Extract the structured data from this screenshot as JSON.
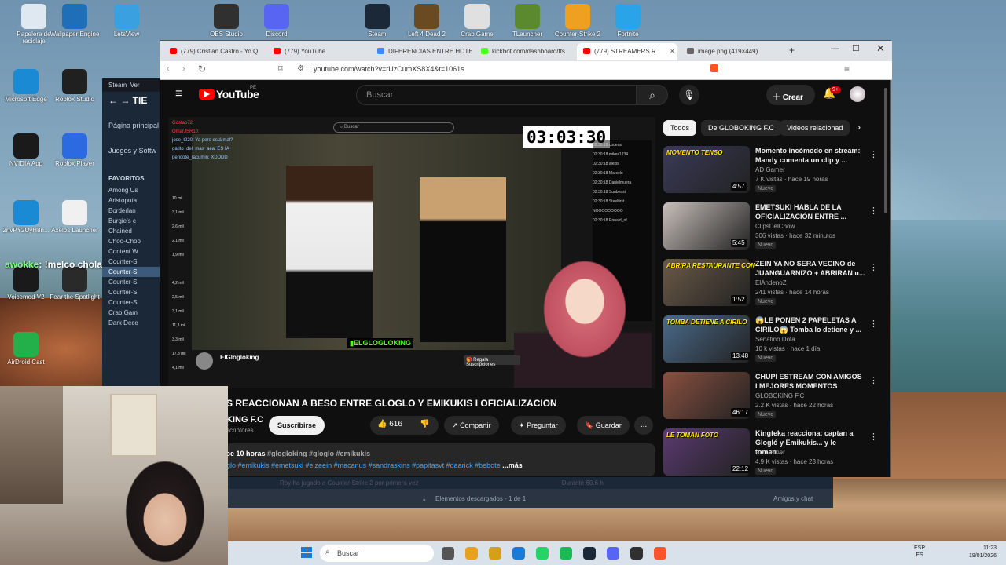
{
  "desktop_icons": [
    {
      "label": "Papelera de reciclaje",
      "icon": "recycle-bin-icon",
      "color": "#dfe8f0"
    },
    {
      "label": "Wallpaper Engine",
      "icon": "wallpaper-engine-icon",
      "color": "#1f6fb8"
    },
    {
      "label": "LetsView",
      "icon": "letsview-icon",
      "color": "#3aa0e0"
    },
    {
      "label": "OBS Studio",
      "icon": "obs-icon",
      "color": "#303030"
    },
    {
      "label": "Discord",
      "icon": "discord-icon",
      "color": "#5865f2"
    },
    {
      "label": "Steam",
      "icon": "steam-icon",
      "color": "#1b2838"
    },
    {
      "label": "Left 4 Dead 2",
      "icon": "l4d2-icon",
      "color": "#6a4a20"
    },
    {
      "label": "Crab Game",
      "icon": "crab-game-icon",
      "color": "#e0e0e0"
    },
    {
      "label": "TLauncher",
      "icon": "tlauncher-icon",
      "color": "#5b8a2e"
    },
    {
      "label": "Counter-Strike 2",
      "icon": "cs2-icon",
      "color": "#f0a020"
    },
    {
      "label": "Fortnite",
      "icon": "fortnite-icon",
      "color": "#2aa4e8"
    },
    {
      "label": "Microsoft Edge",
      "icon": "edge-icon",
      "color": "#1a8ad4"
    },
    {
      "label": "Roblox Studio",
      "icon": "roblox-studio-icon",
      "color": "#202020"
    },
    {
      "label": "NVIDIA App",
      "icon": "nvidia-icon",
      "color": "#1a1a1a"
    },
    {
      "label": "Roblox Player",
      "icon": "roblox-player-icon",
      "color": "#2b6ae0"
    },
    {
      "label": "2nvPY2UyH8n...",
      "icon": "edge-beta-icon",
      "color": "#1a8ad4"
    },
    {
      "label": "Axelos Launcher",
      "icon": "file-icon",
      "color": "#f0f0f0"
    },
    {
      "label": "Voicemod V2",
      "icon": "voicemod-icon",
      "color": "#1a1a1a"
    },
    {
      "label": "Fear the Spotlight",
      "icon": "fear-spotlight-icon",
      "color": "#2a2a2a"
    },
    {
      "label": "AirDroid Cast",
      "icon": "airdroid-icon",
      "color": "#23b04a"
    }
  ],
  "overlay_chat": {
    "user": "awokke",
    "message": ": !melco chola dime si le aguantarías un round a seb"
  },
  "steam": {
    "title": "Steam",
    "menu": "Ver",
    "heading": "TIE",
    "page": "Página principal",
    "games": "Juegos y Softw",
    "favorites": "FAVORITOS",
    "items": [
      "Among Us",
      "Aristoputa",
      "Borderlan",
      "Burgie's c",
      "Chained",
      "Choo-Choo",
      "Content W",
      "Counter-S",
      "Counter-S",
      "Counter-S",
      "Counter-S",
      "Counter-S",
      "Crab Gam",
      "Dark Dece"
    ],
    "footer": "Roy ha jugado a Counter-Strike 2 por primera vez"
  },
  "browser": {
    "tabs": [
      {
        "label": "(779) Cristian Castro - Yo Q",
        "color": "#ff0000"
      },
      {
        "label": "(779) YouTube",
        "color": "#ff0000"
      },
      {
        "label": "DIFERENCIAS ENTRE HOTE",
        "color": "#4285f4"
      },
      {
        "label": "kickbot.com/dashboard/tts",
        "color": "#53fc18"
      },
      {
        "label": "(779) STREAMERS R",
        "color": "#ff0000"
      },
      {
        "label": "image.png (419×449)",
        "color": "#666666"
      }
    ],
    "url": "youtube.com/watch?v=rUzCumXS8X4&t=1061s",
    "new_tab": "+",
    "close": "×"
  },
  "youtube": {
    "logo": "YouTube",
    "region": "PE",
    "search_placeholder": "Buscar",
    "create": "Crear",
    "notif_badge": "9+",
    "chips": [
      "Todos",
      "De GLOBOKING F.C",
      "Videos relacionad"
    ],
    "video": {
      "timer": "03:03:30",
      "channel_overlay": "ElGlogloking",
      "title": "S REACCIONAN A BESO ENTRE GLOGLO Y EMIKUKIS I OFICIALIZACION",
      "channel": "KING F.C",
      "subs": "scriptores",
      "subscribe": "Suscribirse",
      "likes": "616",
      "share": "Compartir",
      "ask": "Preguntar",
      "save": "Guardar",
      "more": "...",
      "desc_meta": "ce 10 horas",
      "desc_tags": "#glogloking #gloglo #emikukis",
      "desc_line2": "glo #emikukis #emetsuki #elzeein #macarius #sandraskins #papitasvt #daarick #bebote",
      "desc_more": "...más",
      "chat_lines": [
        "Gostao72:",
        "OmarJSR10:",
        "jose_t220: Ya pero está mal?",
        "gatito_del_mas_aea: ES IA",
        "pericote_racumin: XDDDD"
      ]
    },
    "related": [
      {
        "title": "Momento incómodo en stream: Mandy comenta un clip y ...",
        "channel": "AD Gamer",
        "meta": "7 K vistas · hace 19 horas",
        "badge": "Nuevo",
        "duration": "4:57",
        "thumb": "#3a3a58",
        "caption": "MOMENTO TENSO"
      },
      {
        "title": "EMETSUKI HABLA DE LA OFICIALIZACIÓN ENTRE ...",
        "channel": "ClipsDelChow",
        "meta": "306 vistas · hace 32 minutos",
        "badge": "Nuevo",
        "duration": "5:45",
        "thumb": "#c9c0bb",
        "caption": ""
      },
      {
        "title": "ZEIN YA NO SERA VECINO de JUANGUARNIZO + ABRIRAN u...",
        "channel": "ElAndenoZ",
        "meta": "241 vistas · hace 14 horas",
        "badge": "Nuevo",
        "duration": "1:52",
        "thumb": "#6b5a48",
        "caption": "ABRIRA RESTAURANTE CON"
      },
      {
        "title": "😱LE PONEN 2 PAPELETAS A CIRILO😱 Tomba lo detiene y ...",
        "channel": "Senatino Dota",
        "meta": "10 k vistas · hace 1 día",
        "badge": "Nuevo",
        "duration": "13:48",
        "thumb": "#4a6a8a",
        "caption": "TOMBA DETIENE A CIRILO"
      },
      {
        "title": "CHUPI ESTREAM  CON AMIGOS I MEJORES MOMENTOS",
        "channel": "GLOBOKING F.C",
        "meta": "2.2 K vistas · hace 22 horas",
        "badge": "Nuevo",
        "duration": "46:17",
        "thumb": "#8a5040",
        "caption": ""
      },
      {
        "title": "Kingteka reacciona: captan a Glogló y Emikukis... y le toman...",
        "channel": "AD Gamer",
        "meta": "4.9 K vistas · hace 23 horas",
        "badge": "Nuevo",
        "duration": "22:12",
        "thumb": "#5a3a70",
        "caption": "LE TOMAN FOTO"
      }
    ]
  },
  "downloads": {
    "text": "Elementos descargados - 1 de 1",
    "friends": "Amigos y chat",
    "right": "Durante 60.6 h"
  },
  "taskbar": {
    "search": "Buscar",
    "lang_top": "ESP",
    "lang_bottom": "ES",
    "time": "11:23",
    "date": "19/01/2026"
  }
}
